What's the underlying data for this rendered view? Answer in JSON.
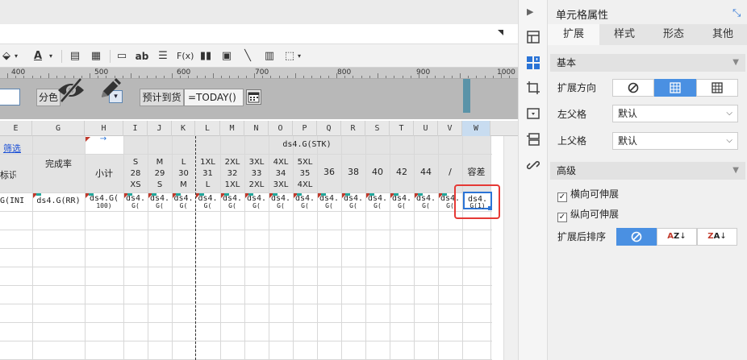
{
  "editor": {
    "ruler_labels": [
      "400",
      "500",
      "600",
      "700",
      "800",
      "900",
      "1000"
    ],
    "param_labels": {
      "group": "分色",
      "eta": "预计到货"
    },
    "param_values": {
      "today": "=TODAY()"
    },
    "col_headers": [
      "E",
      "G",
      "H",
      "I",
      "J",
      "K",
      "L",
      "M",
      "N",
      "O",
      "P",
      "Q",
      "R",
      "S",
      "T",
      "U",
      "V",
      "W"
    ],
    "header_cells": {
      "e_row1": "筛选",
      "e_row2": "标识",
      "completion_rate": "完成率",
      "subtotal": "小计",
      "stk_group": "ds4.G(STK)",
      "size_s": [
        "S",
        "28",
        "XS"
      ],
      "size_m": [
        "M",
        "29",
        "S"
      ],
      "size_l": [
        "L",
        "30",
        "M"
      ],
      "size_1xl": [
        "1XL",
        "31",
        "L"
      ],
      "size_2xl": [
        "2XL",
        "32",
        "1XL"
      ],
      "size_3xl": [
        "3XL",
        "33",
        "2XL"
      ],
      "size_4xl": [
        "4XL",
        "34",
        "3XL"
      ],
      "size_5xl": [
        "5XL",
        "35",
        "4XL"
      ],
      "s36": "36",
      "s38": "38",
      "s40": "40",
      "s42": "42",
      "s44": "44",
      "slash": "/",
      "tolerance": "容差"
    },
    "data_cells": {
      "e": "G(INI)",
      "g": "ds4.G(RR)",
      "h": "ds4.G(",
      "h_sub": "100)",
      "short": "ds4.",
      "short_sub": "G(",
      "w": "ds4.",
      "w_sub": "G(1)"
    }
  },
  "panel": {
    "title": "单元格属性",
    "tabs": [
      "扩展",
      "样式",
      "形态",
      "其他"
    ],
    "active_tab": "扩展",
    "sections": {
      "basic": "基本",
      "advanced": "高级"
    },
    "labels": {
      "expand_dir": "扩展方向",
      "left_parent": "左父格",
      "top_parent": "上父格",
      "sort_after": "扩展后排序"
    },
    "values": {
      "left_parent": "默认",
      "top_parent": "默认"
    },
    "checkboxes": {
      "horizontal": "横向可伸展",
      "vertical": "纵向可伸展"
    }
  },
  "colors": {
    "accent": "#4a90e2",
    "highlight": "#e53935",
    "selection": "#2b74d6"
  }
}
